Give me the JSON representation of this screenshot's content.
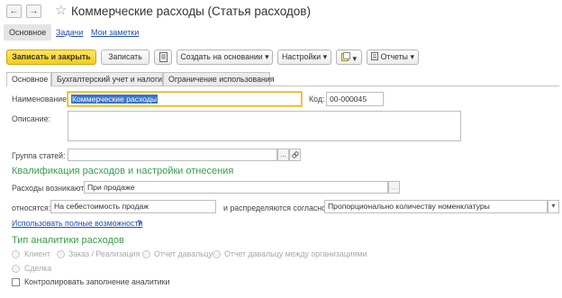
{
  "window": {
    "title": "Коммерческие расходы (Статья расходов)",
    "back_icon": "←",
    "forward_icon": "→",
    "star_icon": "☆"
  },
  "nav_tabs": {
    "main": "Основное",
    "tasks": "Задачи",
    "notes": "Мои заметки"
  },
  "toolbar": {
    "save_close": "Записать и закрыть",
    "save": "Записать",
    "create_based": "Создать на основании",
    "settings": "Настройки",
    "reports": "Отчеты",
    "dropdown_arrow": "▾"
  },
  "form_tabs": [
    "Основное",
    "Бухгалтерский учет и налоги",
    "Ограничение использования"
  ],
  "form": {
    "name_label": "Наименование:",
    "name_value": "Коммерческие расходы",
    "code_label": "Код:",
    "code_value": "00-000045",
    "description_label": "Описание:",
    "description_value": "",
    "group_label": "Группа статей:",
    "group_value": "",
    "dots": "...",
    "section1_title": "Квалификация расходов и настройки отнесения",
    "occur_label": "Расходы возникают:",
    "occur_value": "При продаже",
    "relates_label": "относятся:",
    "relates_value": "На себестоимость продаж",
    "distrib_label": "и распределяются согласно:",
    "distrib_value": "Пропорционально количеству номенклатуры",
    "full_link": "Использовать полные возможности",
    "help": "?",
    "section2_title": "Тип аналитики расходов",
    "radios": [
      "Клиент",
      "Заказ / Реализация",
      "Отчет давальцу",
      "Отчет давальцу между организациями",
      "Сделка"
    ],
    "control_label": "Контролировать заполнение аналитики"
  },
  "colors": {
    "accent_green": "#3b9c4a",
    "primary_button": "#f5cd1b",
    "link": "#1f4fae"
  }
}
